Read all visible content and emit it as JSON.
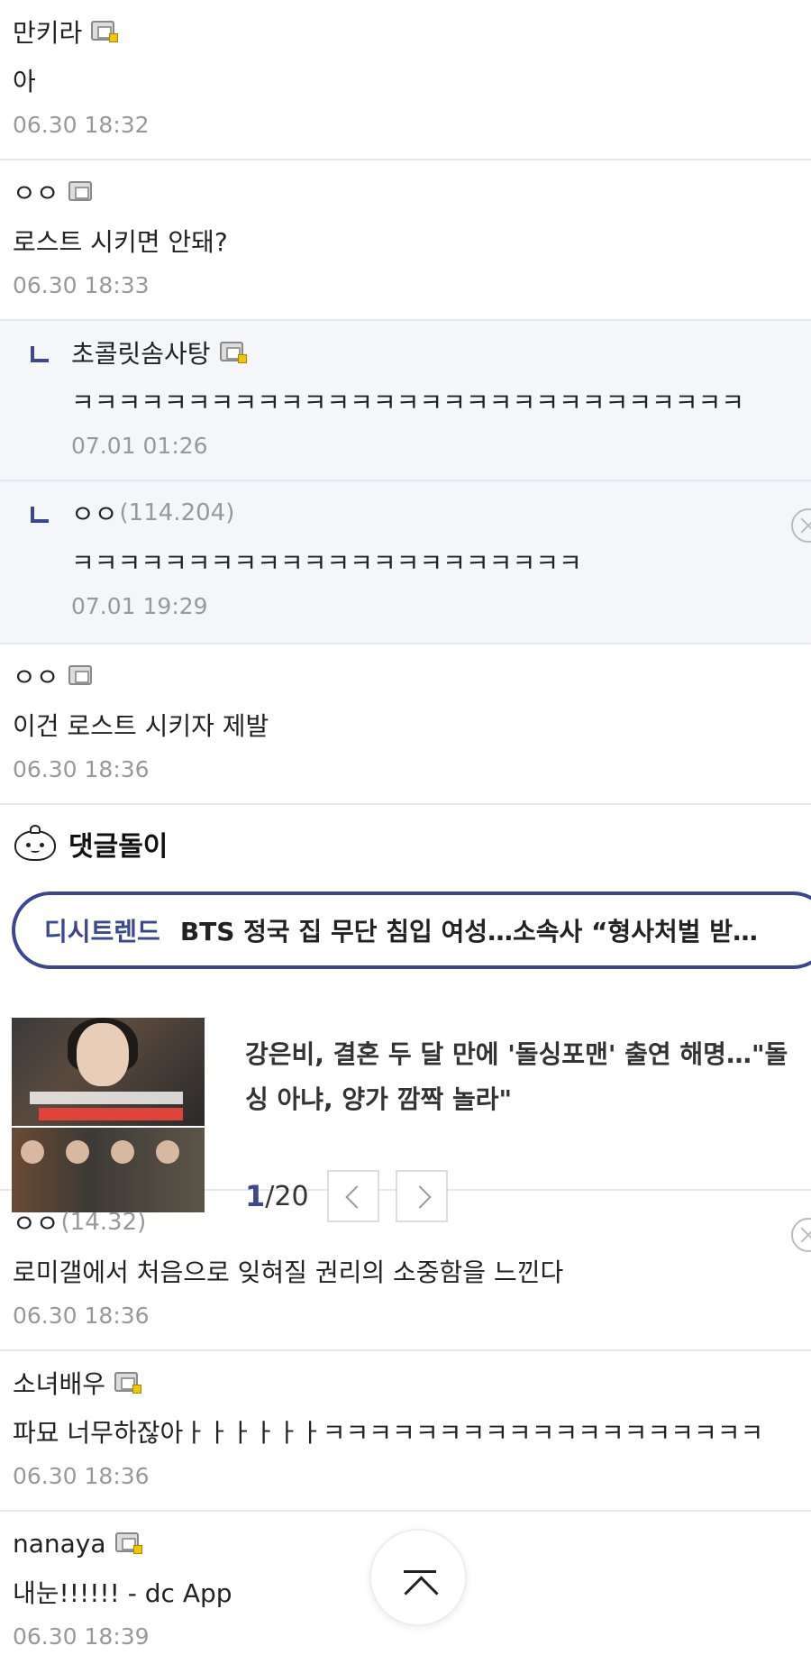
{
  "comments_top": [
    {
      "name": "만키라",
      "icon": "gallog-fixed-icon",
      "body": "아",
      "date": "06.30 18:32"
    },
    {
      "name": "ㅇㅇ",
      "icon": "gallog-icon",
      "body": "로스트 시키면 안돼?",
      "date": "06.30 18:33"
    }
  ],
  "replies": [
    {
      "name": "초콜릿솜사탕",
      "icon": "gallog-fixed-icon",
      "body": "ㅋㅋㅋㅋㅋㅋㅋㅋㅋㅋㅋㅋㅋㅋㅋㅋㅋㅋㅋㅋㅋㅋㅋㅋㅋㅋㅋㅋㅋ",
      "date": "07.01 01:26"
    },
    {
      "name": "ㅇㅇ",
      "ip": "(114.204)",
      "body": "ㅋㅋㅋㅋㅋㅋㅋㅋㅋㅋㅋㅋㅋㅋㅋㅋㅋㅋㅋㅋㅋㅋ",
      "date": "07.01 19:29"
    }
  ],
  "comment_3": {
    "name": "ㅇㅇ",
    "icon": "gallog-icon",
    "body": "이건 로스트 시키자 제발",
    "date": "06.30 18:36"
  },
  "bot": {
    "title": "댓글돌이",
    "trend_label": "디시트렌드",
    "trend_text": "BTS 정국 집 무단 침입 여성…소속사 “형사처벌 받…",
    "news_title_line1": "강은비, 결혼 두 달 만에 '돌싱포맨' 출연 해명…\"돌",
    "news_title_line2": "싱 아냐, 양가 깜짝 놀라\"",
    "page_current": "1",
    "page_total": "/20"
  },
  "comments_bottom": [
    {
      "name": "ㅇㅇ",
      "ip": "(14.32)",
      "body": "로미갤에서 처음으로 잊혀질 권리의 소중함을 느낀다",
      "date": "06.30 18:36"
    },
    {
      "name": "소녀배우",
      "icon": "gallog-fixed-icon",
      "body": "파묘 너무하잖아ㅏㅏㅏㅏㅏㅏㅋㅋㅋㅋㅋㅋㅋㅋㅋㅋㅋㅋㅋㅋㅋㅋㅋㅋㅋ",
      "date": "06.30 18:36"
    },
    {
      "name": "nanaya",
      "icon": "gallog-fixed-icon",
      "body": "내눈!!!!!! - dc App",
      "date": "06.30 18:39"
    }
  ]
}
